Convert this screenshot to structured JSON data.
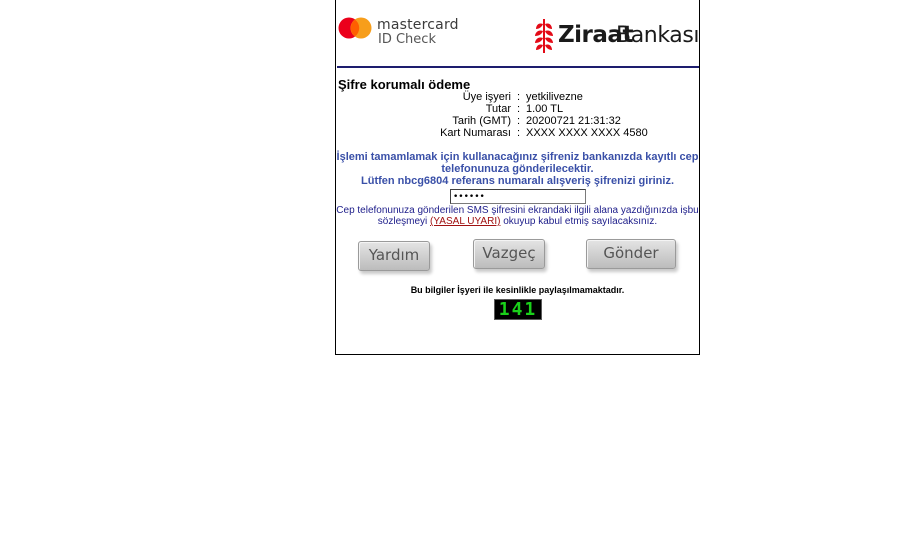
{
  "header": {
    "mastercard_line1": "mastercard",
    "mastercard_line2": "ID Check",
    "bank_name_bold": "Ziraat",
    "bank_name_rest": "Bankası",
    "brand_colors": {
      "mc_red": "#eb001b",
      "mc_orange": "#f79e1b",
      "ziraat_red": "#e30a17"
    }
  },
  "title": "Şifre korumalı ödeme",
  "info": {
    "rows": [
      {
        "label": "Üye işyeri",
        "value": "yetkilivezne"
      },
      {
        "label": "Tutar",
        "value": "1.00 TL"
      },
      {
        "label": "Tarih (GMT)",
        "value": "20200721 21:31:32"
      },
      {
        "label": "Kart Numarası",
        "value": "XXXX XXXX XXXX 4580"
      }
    ],
    "separator": ":"
  },
  "message": {
    "line1": "İşlemi tamamlamak için kullanacağınız şifreniz bankanızda kayıtlı cep telefonunuza gönderilecektir.",
    "line2": "Lütfen nbcg6804 referans numaralı alışveriş şifrenizi giriniz."
  },
  "password": {
    "value": "••••••"
  },
  "legal": {
    "text_before": "Cep telefonunuza gönderilen SMS şifresini ekrandaki ilgili alana yazdığınızda işbu sözleşmeyi ",
    "link": "(YASAL UYARI)",
    "text_after": " okuyup kabul etmiş sayılacaksınız."
  },
  "buttons": {
    "help": "Yardım",
    "cancel": "Vazgeç",
    "send": "Gönder"
  },
  "notice": "Bu bilgiler İşyeri ile kesinlikle paylaşılmamaktadır.",
  "countdown": "141"
}
